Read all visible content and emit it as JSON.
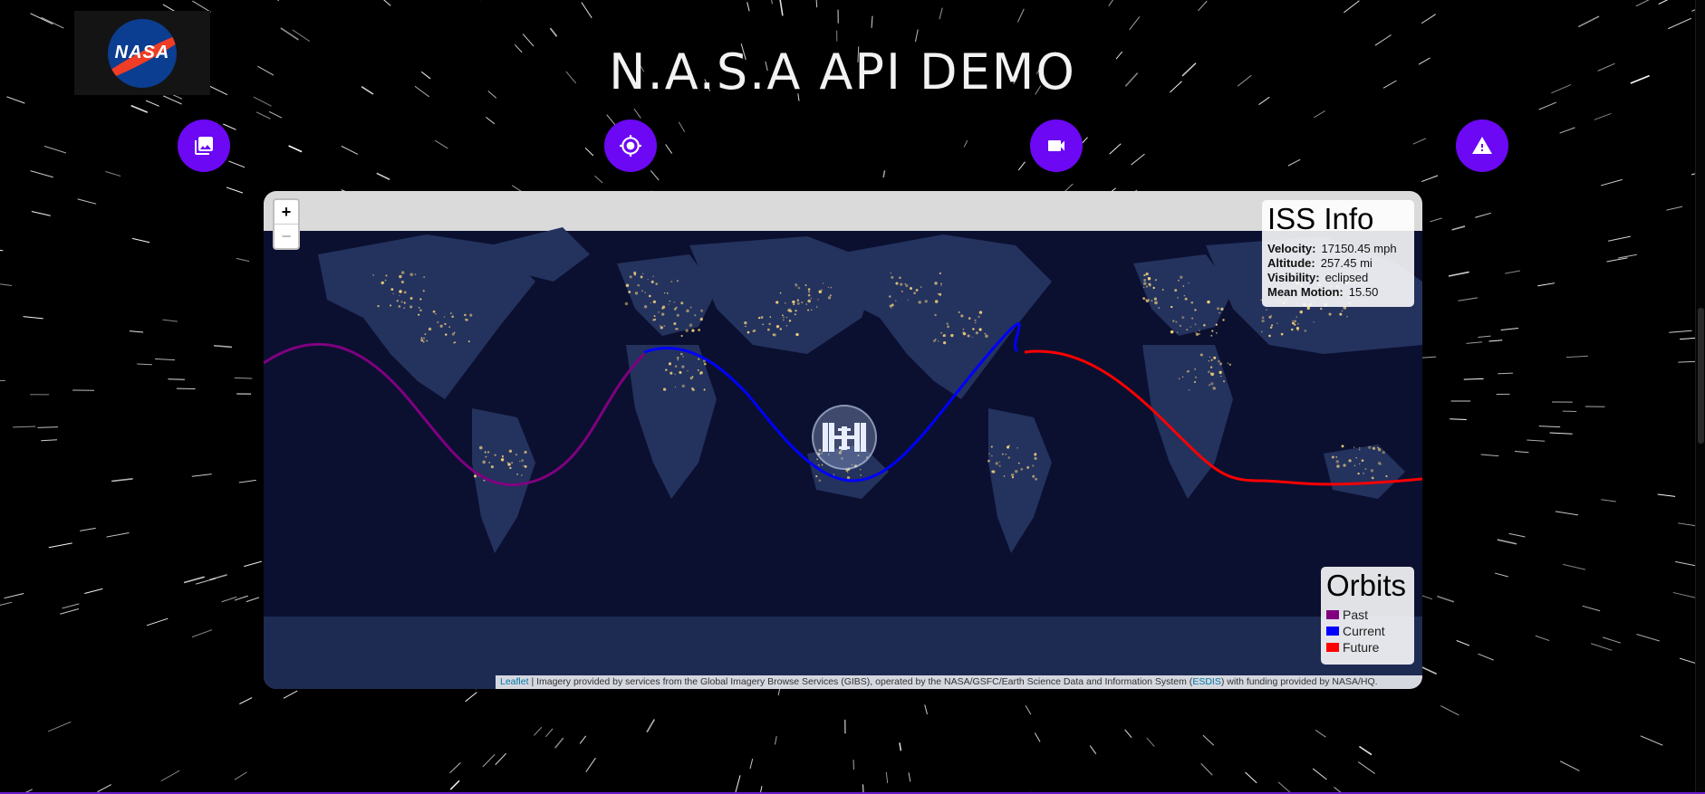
{
  "header": {
    "logo_text": "NASA",
    "title": "N.A.S.A API DEMO"
  },
  "nav": [
    {
      "icon": "photo-library-icon"
    },
    {
      "icon": "gps-location-icon"
    },
    {
      "icon": "videocam-icon"
    },
    {
      "icon": "warning-icon"
    }
  ],
  "map": {
    "zoom_in_label": "+",
    "zoom_out_label": "−",
    "iss_info": {
      "title": "ISS Info",
      "velocity_label": "Velocity:",
      "velocity_value": "17150.45 mph",
      "altitude_label": "Altitude:",
      "altitude_value": "257.45 mi",
      "visibility_label": "Visibility:",
      "visibility_value": "eclipsed",
      "mean_motion_label": "Mean Motion:",
      "mean_motion_value": "15.50"
    },
    "legend": {
      "title": "Orbits",
      "items": [
        {
          "label": "Past",
          "color": "#800080"
        },
        {
          "label": "Current",
          "color": "#0000ff"
        },
        {
          "label": "Future",
          "color": "#ff0000"
        }
      ]
    },
    "attribution": {
      "leaflet": "Leaflet",
      "text_1": " | Imagery provided by services from the Global Imagery Browse Services (GIBS), operated by the NASA/GSFC/Earth Science Data and Information System (",
      "esdis": "ESDIS",
      "text_2": ") with funding provided by NASA/HQ."
    }
  },
  "colors": {
    "accent": "#6c08f3",
    "ocean": "#0b1030",
    "land": "#24325e",
    "lights": "#f5d27a"
  }
}
